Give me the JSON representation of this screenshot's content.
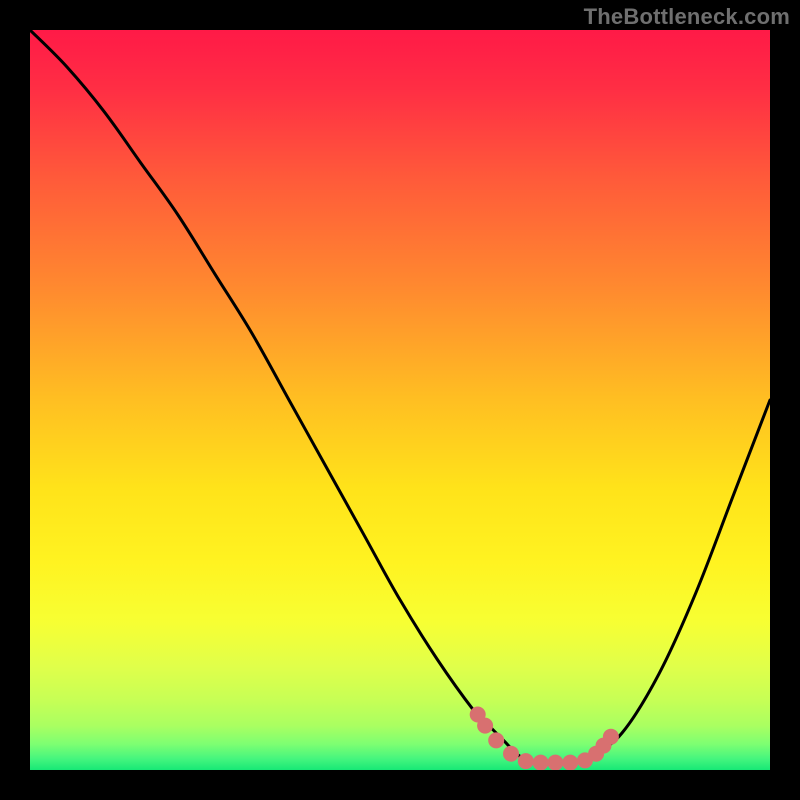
{
  "watermark": "TheBottleneck.com",
  "colors": {
    "background": "#000000",
    "curve": "#000000",
    "marker": "#d87070",
    "gradient_stops": [
      {
        "offset": 0.0,
        "color": "#ff1a47"
      },
      {
        "offset": 0.08,
        "color": "#ff2e44"
      },
      {
        "offset": 0.2,
        "color": "#ff5a3a"
      },
      {
        "offset": 0.35,
        "color": "#ff8a2f"
      },
      {
        "offset": 0.5,
        "color": "#ffbf22"
      },
      {
        "offset": 0.62,
        "color": "#ffe31a"
      },
      {
        "offset": 0.72,
        "color": "#fff321"
      },
      {
        "offset": 0.8,
        "color": "#f7ff33"
      },
      {
        "offset": 0.86,
        "color": "#e0ff4a"
      },
      {
        "offset": 0.905,
        "color": "#c7ff55"
      },
      {
        "offset": 0.94,
        "color": "#aaff61"
      },
      {
        "offset": 0.965,
        "color": "#7dff72"
      },
      {
        "offset": 0.985,
        "color": "#45f57e"
      },
      {
        "offset": 1.0,
        "color": "#17e876"
      }
    ]
  },
  "chart_data": {
    "type": "line",
    "title": "",
    "xlabel": "",
    "ylabel": "",
    "xlim": [
      0,
      100
    ],
    "ylim": [
      0,
      100
    ],
    "series": [
      {
        "name": "bottleneck-curve",
        "x": [
          0,
          5,
          10,
          15,
          20,
          25,
          30,
          35,
          40,
          45,
          50,
          55,
          60,
          62,
          64,
          66,
          68,
          70,
          72,
          74,
          76,
          80,
          85,
          90,
          95,
          100
        ],
        "y": [
          100,
          95,
          89,
          82,
          75,
          67,
          59,
          50,
          41,
          32,
          23,
          15,
          8,
          6,
          4,
          2,
          1,
          1,
          1,
          1,
          2,
          5,
          13,
          24,
          37,
          50
        ]
      }
    ],
    "markers": {
      "name": "highlight-points",
      "x": [
        60.5,
        61.5,
        63,
        65,
        67,
        69,
        71,
        73,
        75,
        76.5,
        77.5,
        78.5
      ],
      "y": [
        7.5,
        6,
        4,
        2.2,
        1.2,
        1,
        1,
        1,
        1.3,
        2.2,
        3.3,
        4.5
      ]
    }
  }
}
